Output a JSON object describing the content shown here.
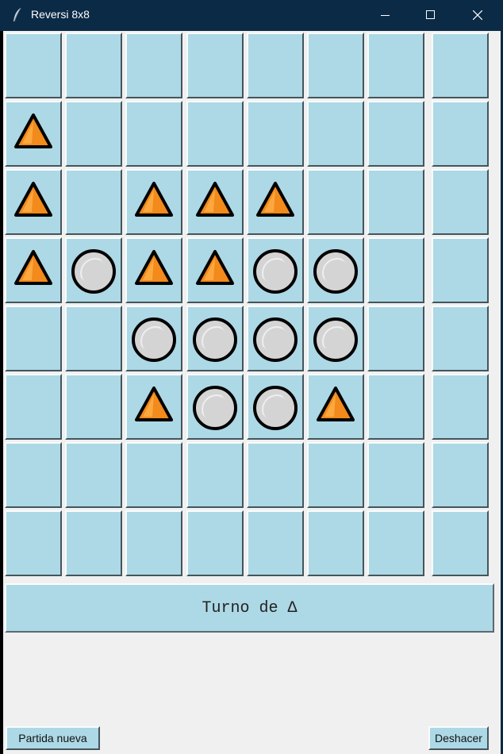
{
  "window": {
    "title": "Reversi 8x8",
    "icon": "feather-icon",
    "controls": [
      "minimize-icon",
      "maximize-icon",
      "close-icon"
    ]
  },
  "colors": {
    "titlebar": "#0b2a45",
    "cell": "#add8e6",
    "triangle_fill": "#f28a1c",
    "triangle_highlight": "#ffb24a",
    "circle_fill": "#d4d4d4",
    "circle_highlight": "#f2f2f2",
    "piece_outline": "#000000"
  },
  "board": {
    "rows": 8,
    "cols": 8,
    "legend": {
      ".": "empty",
      "T": "triangle",
      "O": "circle"
    },
    "cells": [
      "........",
      "T.......",
      "T.TTT...",
      "TOTTOO..",
      "..OOOO..",
      "..TOOT..",
      "........",
      "........"
    ]
  },
  "status": {
    "text": "Turno de Δ"
  },
  "buttons": {
    "new_game": "Partida nueva",
    "undo": "Deshacer"
  }
}
